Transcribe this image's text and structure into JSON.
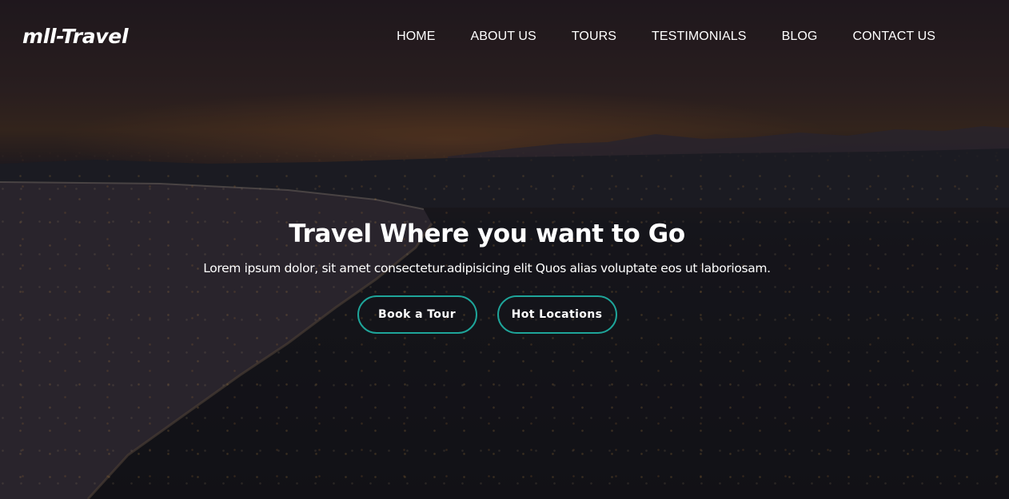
{
  "brand": {
    "logo_text": "mll-Travel"
  },
  "nav": {
    "items": [
      {
        "label": "HOME"
      },
      {
        "label": "ABOUT US"
      },
      {
        "label": "TOURS"
      },
      {
        "label": "TESTIMONIALS"
      },
      {
        "label": "BLOG"
      },
      {
        "label": "CONTACT US"
      }
    ]
  },
  "hero": {
    "title": "Travel Where you want to Go",
    "subtitle": "Lorem ipsum dolor, sit amet consectetur.adipisicing elit Quos alias voluptate eos ut laboriosam.",
    "buttons": {
      "book_label": "Book a Tour",
      "hot_label": "Hot Locations"
    }
  },
  "colors": {
    "accent": "#1ea59a",
    "text": "#ffffff",
    "overlay": "#0c0a0e"
  }
}
